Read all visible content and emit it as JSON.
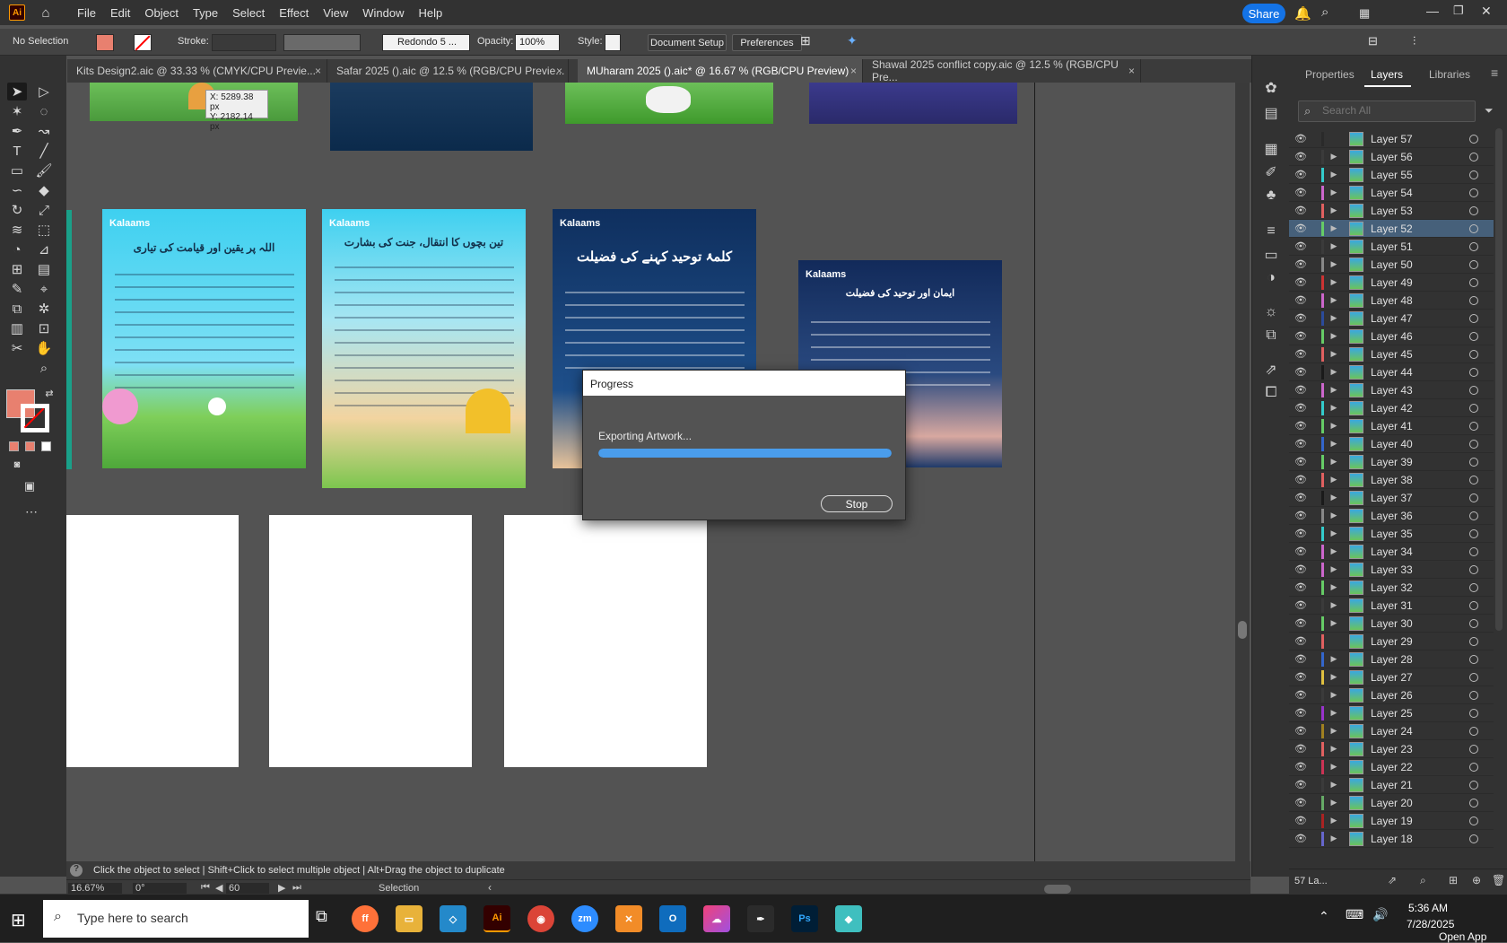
{
  "app": {
    "logo": "Ai"
  },
  "menu": [
    "File",
    "Edit",
    "Object",
    "Type",
    "Select",
    "Effect",
    "View",
    "Window",
    "Help"
  ],
  "share_label": "Share",
  "control_bar": {
    "selection": "No Selection",
    "stroke_label": "Stroke:",
    "brush": "Redondo 5 ...",
    "opacity_label": "Opacity:",
    "opacity_value": "100%",
    "style_label": "Style:",
    "document_setup": "Document Setup",
    "preferences": "Preferences"
  },
  "tabs": [
    {
      "label": "Kits Design2.aic @ 33.33 % (CMYK/CPU Previe...",
      "active": false
    },
    {
      "label": "Safar 2025 ().aic @ 12.5 % (RGB/CPU Previe...",
      "active": false
    },
    {
      "label": "MUharam 2025 ().aic* @ 16.67 % (RGB/CPU Preview)",
      "active": true
    },
    {
      "label": "Shawal 2025 conflict copy.aic @ 12.5 % (RGB/CPU Pre...",
      "active": false
    }
  ],
  "tab_close": "×",
  "cursor_readout": {
    "x": "X: 5289.38 px",
    "y": "Y: 2182.14 px"
  },
  "panel_tabs": [
    "Properties",
    "Layers",
    "Libraries"
  ],
  "layers_search_placeholder": "Search All",
  "layers": [
    {
      "name": "Layer 57",
      "color": "#2a2a2a",
      "expandable": false
    },
    {
      "name": "Layer 56",
      "color": "#3b3b3b",
      "expandable": true
    },
    {
      "name": "Layer 55",
      "color": "#33cccc",
      "expandable": true
    },
    {
      "name": "Layer 54",
      "color": "#cc66cc",
      "expandable": true
    },
    {
      "name": "Layer 53",
      "color": "#e06060",
      "expandable": true
    },
    {
      "name": "Layer 52",
      "color": "#66cc66",
      "expandable": true,
      "selected": true
    },
    {
      "name": "Layer 51",
      "color": "#3b3b3b",
      "expandable": true
    },
    {
      "name": "Layer 50",
      "color": "#888888",
      "expandable": true
    },
    {
      "name": "Layer 49",
      "color": "#cc3333",
      "expandable": true
    },
    {
      "name": "Layer 48",
      "color": "#cc66cc",
      "expandable": true
    },
    {
      "name": "Layer 47",
      "color": "#2b4b9b",
      "expandable": true
    },
    {
      "name": "Layer 46",
      "color": "#66cc66",
      "expandable": true
    },
    {
      "name": "Layer 45",
      "color": "#e06060",
      "expandable": true
    },
    {
      "name": "Layer 44",
      "color": "#1a1a1a",
      "expandable": true
    },
    {
      "name": "Layer 43",
      "color": "#cc66cc",
      "expandable": true
    },
    {
      "name": "Layer 42",
      "color": "#33cccc",
      "expandable": true
    },
    {
      "name": "Layer 41",
      "color": "#66cc66",
      "expandable": true
    },
    {
      "name": "Layer 40",
      "color": "#3366cc",
      "expandable": true
    },
    {
      "name": "Layer 39",
      "color": "#66cc66",
      "expandable": true
    },
    {
      "name": "Layer 38",
      "color": "#e06060",
      "expandable": true
    },
    {
      "name": "Layer 37",
      "color": "#1a1a1a",
      "expandable": true
    },
    {
      "name": "Layer 36",
      "color": "#888888",
      "expandable": true
    },
    {
      "name": "Layer 35",
      "color": "#33cccc",
      "expandable": true
    },
    {
      "name": "Layer 34",
      "color": "#cc66cc",
      "expandable": true
    },
    {
      "name": "Layer 33",
      "color": "#cc66cc",
      "expandable": true
    },
    {
      "name": "Layer 32",
      "color": "#66cc66",
      "expandable": true
    },
    {
      "name": "Layer 31",
      "color": "#3b3b3b",
      "expandable": true
    },
    {
      "name": "Layer 30",
      "color": "#66cc66",
      "expandable": true
    },
    {
      "name": "Layer 29",
      "color": "#e06060",
      "expandable": false
    },
    {
      "name": "Layer 28",
      "color": "#3366cc",
      "expandable": true
    },
    {
      "name": "Layer 27",
      "color": "#e0c040",
      "expandable": true
    },
    {
      "name": "Layer 26",
      "color": "#3b3b3b",
      "expandable": true
    },
    {
      "name": "Layer 25",
      "color": "#9933cc",
      "expandable": true
    },
    {
      "name": "Layer 24",
      "color": "#a08020",
      "expandable": true
    },
    {
      "name": "Layer 23",
      "color": "#e06060",
      "expandable": true
    },
    {
      "name": "Layer 22",
      "color": "#cc3355",
      "expandable": true
    },
    {
      "name": "Layer 21",
      "color": "#3b3b3b",
      "expandable": true
    },
    {
      "name": "Layer 20",
      "color": "#66aa66",
      "expandable": true
    },
    {
      "name": "Layer 19",
      "color": "#aa2222",
      "expandable": true
    },
    {
      "name": "Layer 18",
      "color": "#6666cc",
      "expandable": true
    }
  ],
  "layers_count": "57 La...",
  "dialog": {
    "title": "Progress",
    "message": "Exporting Artwork...",
    "progress": 1.0,
    "stop_label": "Stop"
  },
  "posters": [
    {
      "title": "اللہ پر یقین اور قیامت کی تیاری",
      "logo": "Kalaams"
    },
    {
      "title": "تین بچوں کا انتقال، جنت کی بشارت",
      "logo": "Kalaams"
    },
    {
      "title": "کلمۂ توحید کہنے کی فضیلت",
      "logo": "Kalaams"
    },
    {
      "title": "ایمان اور توحید کی فضیلت",
      "logo": "Kalaams"
    }
  ],
  "status": {
    "hint": "Click the object to select  |  Shift+Click to select multiple object  |  Alt+Drag the object to duplicate",
    "zoom": "16.67%",
    "rotate": "0°",
    "artboard": "60",
    "mode": "Selection"
  },
  "taskbar": {
    "search_placeholder": "Type here to search",
    "time": "5:36 AM",
    "date": "7/28/2025",
    "open_app": "Open App"
  }
}
